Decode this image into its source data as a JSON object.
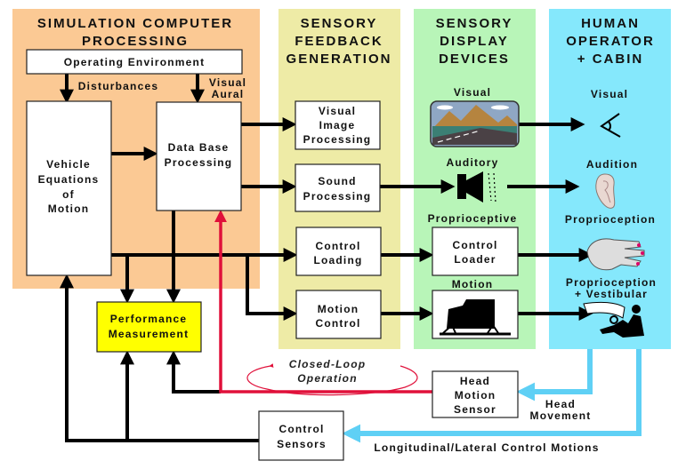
{
  "panels": {
    "simulation": {
      "title_1": "SIMULATION COMPUTER",
      "title_2": "PROCESSING",
      "color": "#fbc994"
    },
    "feedback": {
      "title_1": "SENSORY",
      "title_2": "FEEDBACK",
      "title_3": "GENERATION",
      "color": "#eeeba6"
    },
    "display": {
      "title_1": "SENSORY",
      "title_2": "DISPLAY",
      "title_3": "DEVICES",
      "color": "#b8f5b8"
    },
    "operator": {
      "title_1": "HUMAN",
      "title_2": "OPERATOR",
      "title_3": "+ CABIN",
      "color": "#85e8fc"
    }
  },
  "boxes": {
    "operating_environment": "Operating Environment",
    "vehicle_eom": [
      "Vehicle",
      "Equations",
      "of",
      "Motion"
    ],
    "data_base": [
      "Data Base",
      "Processing"
    ],
    "visual_image": [
      "Visual",
      "Image",
      "Processing"
    ],
    "sound": [
      "Sound",
      "Processing"
    ],
    "control_loading": [
      "Control",
      "Loading"
    ],
    "motion_control": [
      "Motion",
      "Control"
    ],
    "control_loader": [
      "Control",
      "Loader"
    ],
    "performance": [
      "Performance",
      "Measurement"
    ],
    "head_motion_sensor": [
      "Head",
      "Motion",
      "Sensor"
    ],
    "control_sensors": [
      "Control",
      "Sensors"
    ]
  },
  "labels": {
    "disturbances": "Disturbances",
    "visual_aural": [
      "Visual",
      "Aural"
    ],
    "display_visual": "Visual",
    "display_auditory": "Auditory",
    "display_proprioceptive": "Proprioceptive",
    "display_motion": "Motion",
    "op_visual": "Visual",
    "op_audition": "Audition",
    "op_proprioception": "Proprioception",
    "op_prop_vest": [
      "Proprioception",
      "+ Vestibular"
    ],
    "closed_loop": [
      "Closed-Loop",
      "Operation"
    ],
    "head_movement": [
      "Head",
      "Movement"
    ],
    "control_motions": "Longitudinal/Lateral Control Motions"
  },
  "icons": [
    "landscape-display-icon",
    "speaker-icon",
    "eye-icon",
    "ear-icon",
    "hand-icon",
    "motion-platform-icon",
    "seated-operator-icon"
  ],
  "colors": {
    "performance_box": "#ffff00",
    "closed_loop": "#e0103a",
    "human_feedback": "#5fd0f5"
  }
}
